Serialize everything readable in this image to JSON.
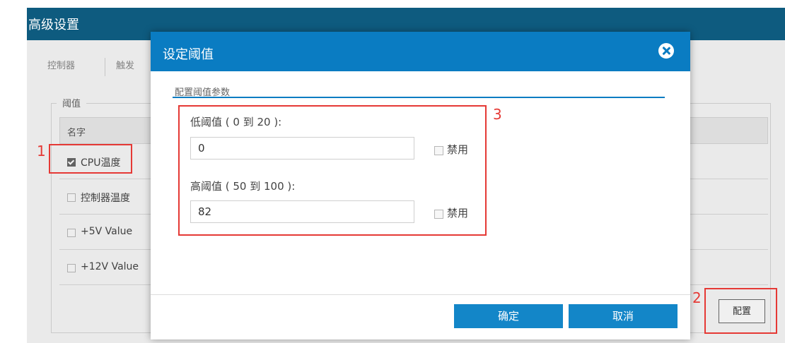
{
  "page": {
    "title": "高级设置",
    "tabs": [
      "控制器",
      "触发"
    ],
    "fieldset_legend": "阈值",
    "table_header": "名字",
    "rows": [
      {
        "label": "CPU温度",
        "checked": true
      },
      {
        "label": "控制器温度",
        "checked": false
      },
      {
        "label": "+5V Value",
        "checked": false
      },
      {
        "label": "+12V Value",
        "checked": false
      }
    ],
    "config_button": "配置"
  },
  "modal": {
    "title": "设定阈值",
    "section_title": "配置阈值参数",
    "low": {
      "label": "低阈值 ( 0 到 20 ):",
      "value": "0",
      "disable_label": "禁用",
      "disabled": false
    },
    "high": {
      "label": "高阈值 ( 50 到 100 ):",
      "value": "82",
      "disable_label": "禁用",
      "disabled": false
    },
    "ok_button": "确定",
    "cancel_button": "取消"
  },
  "annotations": [
    "1",
    "2",
    "3"
  ],
  "icons": {
    "close": "close-circle-icon",
    "checkbox": "checkbox-icon"
  },
  "colors": {
    "header": "#0e5b7f",
    "modal_header": "#0a7cc2",
    "button": "#1386c8",
    "annotation": "#e53935"
  }
}
